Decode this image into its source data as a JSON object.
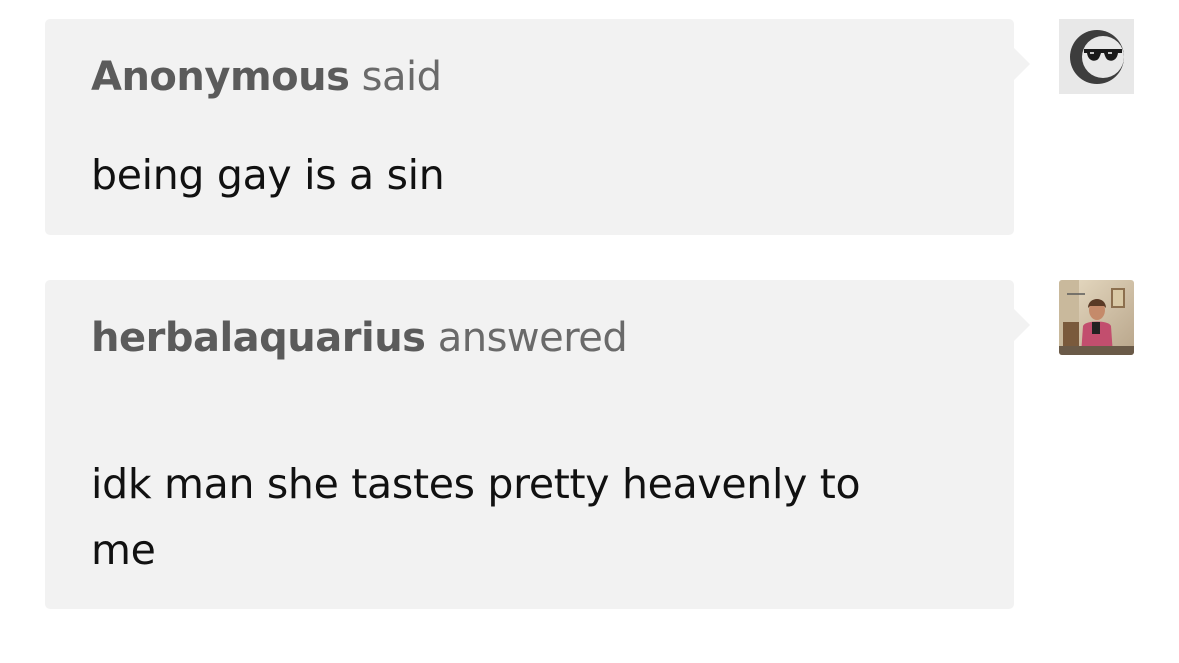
{
  "ask": {
    "asker_name": "Anonymous",
    "asker_verb": " said",
    "question": "being gay is a sin",
    "avatar_icon": "sunglasses-face-icon"
  },
  "answer": {
    "answerer_name": "herbalaquarius",
    "answerer_verb": " answered",
    "reply": "idk man she tastes pretty heavenly to me",
    "avatar_icon": "user-photo-avatar"
  },
  "colors": {
    "bubble_bg": "#f2f2f2",
    "header_text": "#5b5b5b",
    "body_text": "#111111"
  }
}
